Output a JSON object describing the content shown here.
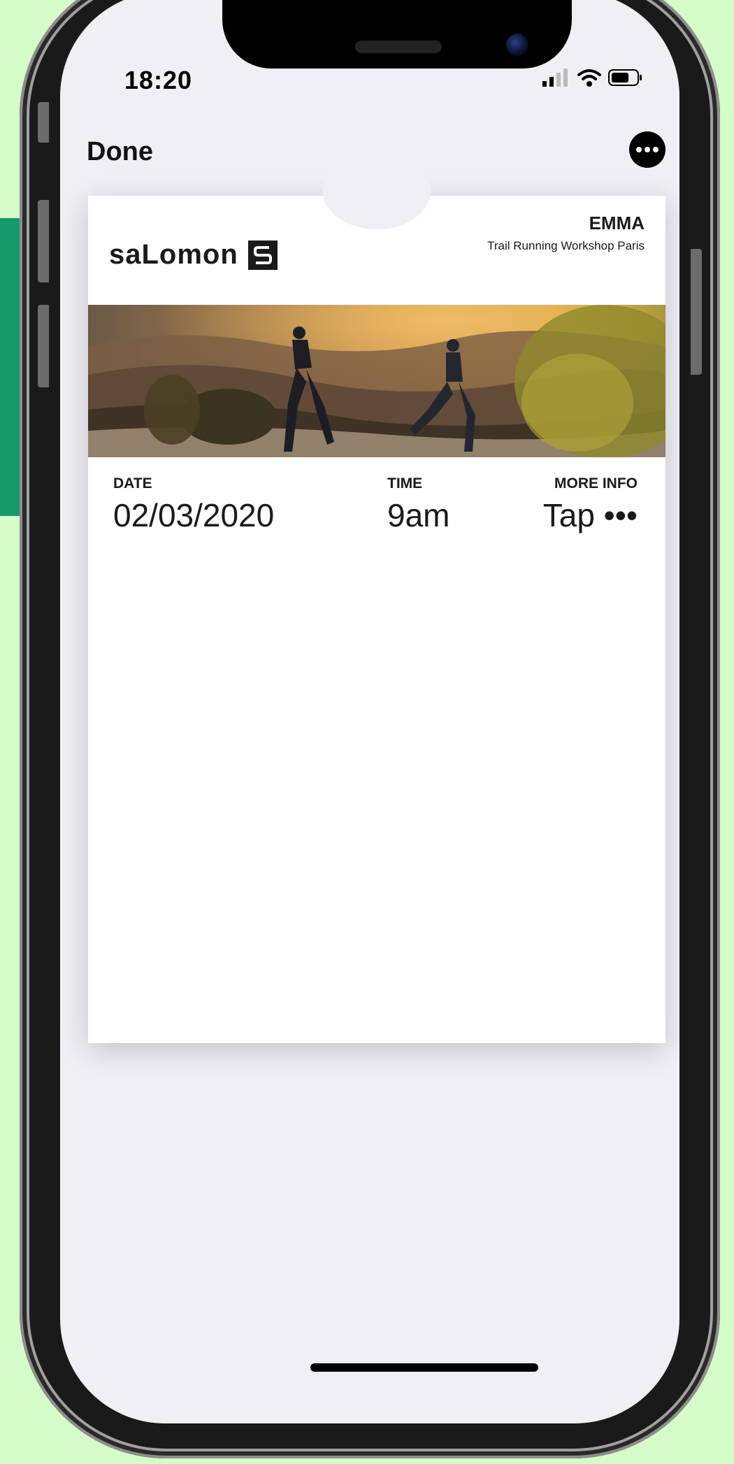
{
  "status_bar": {
    "time": "18:20"
  },
  "nav": {
    "done_label": "Done",
    "more_icon": "ellipsis-icon"
  },
  "pass": {
    "brand": "saLomon",
    "name": "EMMA",
    "event": "Trail Running Workshop Paris",
    "fields": [
      {
        "label": "DATE",
        "value": "02/03/2020"
      },
      {
        "label": "TIME",
        "value": "9am"
      },
      {
        "label": "MORE INFO",
        "value": "Tap •••"
      }
    ]
  },
  "colors": {
    "accent": "#159a6c",
    "background": "#d6fcca",
    "screen": "#efeff4"
  }
}
